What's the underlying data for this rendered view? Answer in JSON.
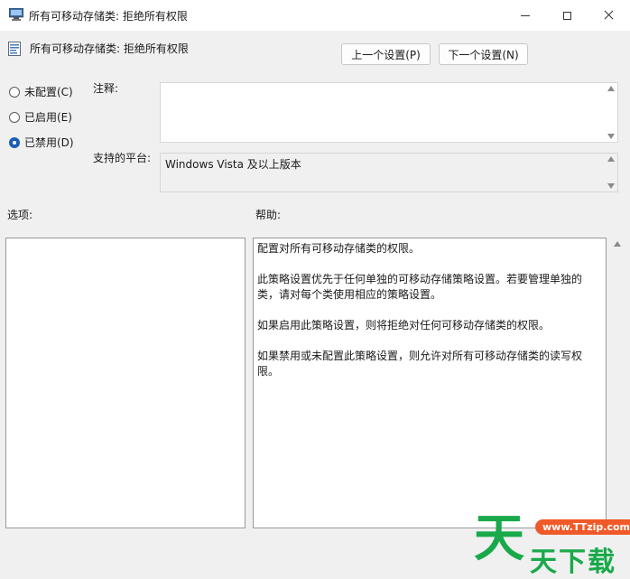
{
  "window": {
    "title": "所有可移动存储类: 拒绝所有权限",
    "icons": {
      "app": "policy-window-icon",
      "minimize": "minimize-icon",
      "maximize": "maximize-icon",
      "close": "close-icon"
    }
  },
  "header": {
    "policy_name": "所有可移动存储类: 拒绝所有权限",
    "prev_button": "上一个设置(P)",
    "next_button": "下一个设置(N)"
  },
  "state": {
    "options": [
      {
        "label": "未配置(C)",
        "checked": false
      },
      {
        "label": "已启用(E)",
        "checked": false
      },
      {
        "label": "已禁用(D)",
        "checked": true
      }
    ]
  },
  "fields": {
    "comment_label": "注释:",
    "comment_value": "",
    "platform_label": "支持的平台:",
    "platform_value": "Windows Vista 及以上版本"
  },
  "panes": {
    "options_label": "选项:",
    "help_label": "帮助:",
    "help_paragraphs": [
      "配置对所有可移动存储类的权限。",
      "此策略设置优先于任何单独的可移动存储策略设置。若要管理单独的类，请对每个类使用相应的策略设置。",
      "如果启用此策略设置，则将拒绝对任何可移动存储类的权限。",
      "如果禁用或未配置此策略设置，则允许对所有可移动存储类的读写权限。"
    ]
  },
  "watermark": {
    "big_char": "天",
    "url": "www.TTzip.com",
    "small_text": "天下载"
  },
  "colors": {
    "accent": "#1a5fb4",
    "watermark_green": "#19a94a",
    "watermark_orange": "#f05a28"
  }
}
